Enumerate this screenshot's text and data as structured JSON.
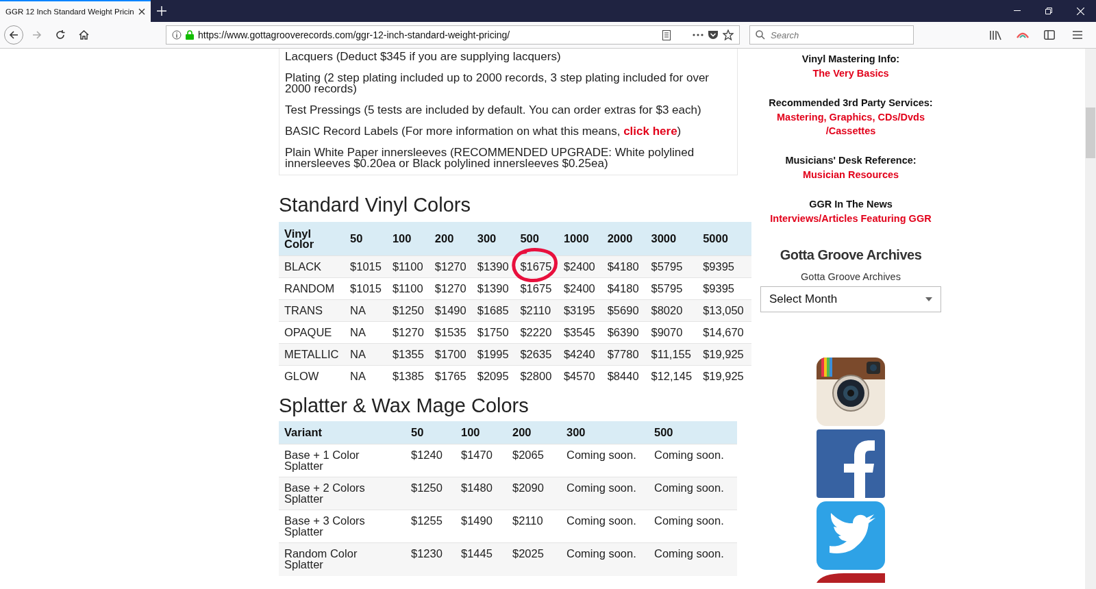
{
  "browser": {
    "tab": {
      "title": "GGR 12 Inch Standard Weight Pricin",
      "selected": true
    },
    "url": "https://www.gottagrooverecords.com/ggr-12-inch-standard-weight-pricing/",
    "search": {
      "placeholder": "Search"
    }
  },
  "includes": [
    {
      "text": "Lacquers (Deduct $345 if you are supplying lacquers)"
    },
    {
      "text": "Plating (2 step plating included up to 2000 records, 3 step plating included for over 2000 records)"
    },
    {
      "text": "Test Pressings (5 tests are included by default. You can order extras for $3 each)"
    },
    {
      "text": "BASIC Record Labels (For more information on what this means, ",
      "link": "click here",
      "after": ")"
    },
    {
      "text": "Plain White Paper innersleeves (RECOMMENDED UPGRADE: White polylined innersleeves $0.20ea or Black polylined innersleeves $0.25ea)"
    }
  ],
  "standard": {
    "title": "Standard Vinyl Colors",
    "columns": [
      "Vinyl Color",
      "50",
      "100",
      "200",
      "300",
      "500",
      "1000",
      "2000",
      "3000",
      "5000"
    ],
    "rows": [
      {
        "cells": [
          {
            "text": "BLACK",
            "circled": false
          },
          {
            "text": "$1015",
            "circled": false
          },
          {
            "text": "$1100",
            "circled": false
          },
          {
            "text": "$1270",
            "circled": false
          },
          {
            "text": "$1390",
            "circled": false
          },
          {
            "text": "$1675",
            "circled": true
          },
          {
            "text": "$2400",
            "circled": false
          },
          {
            "text": "$4180",
            "circled": false
          },
          {
            "text": "$5795",
            "circled": false
          },
          {
            "text": "$9395",
            "circled": false
          }
        ]
      },
      {
        "cells": [
          {
            "text": "RANDOM",
            "circled": false
          },
          {
            "text": "$1015",
            "circled": false
          },
          {
            "text": "$1100",
            "circled": false
          },
          {
            "text": "$1270",
            "circled": false
          },
          {
            "text": "$1390",
            "circled": false
          },
          {
            "text": "$1675",
            "circled": false
          },
          {
            "text": "$2400",
            "circled": false
          },
          {
            "text": "$4180",
            "circled": false
          },
          {
            "text": "$5795",
            "circled": false
          },
          {
            "text": "$9395",
            "circled": false
          }
        ]
      },
      {
        "cells": [
          {
            "text": "TRANS",
            "circled": false
          },
          {
            "text": "NA",
            "circled": false
          },
          {
            "text": "$1250",
            "circled": false
          },
          {
            "text": "$1490",
            "circled": false
          },
          {
            "text": "$1685",
            "circled": false
          },
          {
            "text": "$2110",
            "circled": false
          },
          {
            "text": "$3195",
            "circled": false
          },
          {
            "text": "$5690",
            "circled": false
          },
          {
            "text": "$8020",
            "circled": false
          },
          {
            "text": "$13,050",
            "circled": false
          }
        ]
      },
      {
        "cells": [
          {
            "text": "OPAQUE",
            "circled": false
          },
          {
            "text": "NA",
            "circled": false
          },
          {
            "text": "$1270",
            "circled": false
          },
          {
            "text": "$1535",
            "circled": false
          },
          {
            "text": "$1750",
            "circled": false
          },
          {
            "text": "$2220",
            "circled": false
          },
          {
            "text": "$3545",
            "circled": false
          },
          {
            "text": "$6390",
            "circled": false
          },
          {
            "text": "$9070",
            "circled": false
          },
          {
            "text": "$14,670",
            "circled": false
          }
        ]
      },
      {
        "cells": [
          {
            "text": "METALLIC",
            "circled": false
          },
          {
            "text": "NA",
            "circled": false
          },
          {
            "text": "$1355",
            "circled": false
          },
          {
            "text": "$1700",
            "circled": false
          },
          {
            "text": "$1995",
            "circled": false
          },
          {
            "text": "$2635",
            "circled": false
          },
          {
            "text": "$4240",
            "circled": false
          },
          {
            "text": "$7780",
            "circled": false
          },
          {
            "text": "$11,155",
            "circled": false
          },
          {
            "text": "$19,925",
            "circled": false
          }
        ]
      },
      {
        "cells": [
          {
            "text": "GLOW",
            "circled": false
          },
          {
            "text": "NA",
            "circled": false
          },
          {
            "text": "$1385",
            "circled": false
          },
          {
            "text": "$1765",
            "circled": false
          },
          {
            "text": "$2095",
            "circled": false
          },
          {
            "text": "$2800",
            "circled": false
          },
          {
            "text": "$4570",
            "circled": false
          },
          {
            "text": "$8440",
            "circled": false
          },
          {
            "text": "$12,145",
            "circled": false
          },
          {
            "text": "$19,925",
            "circled": false
          }
        ]
      }
    ]
  },
  "splatter": {
    "title": "Splatter & Wax Mage Colors",
    "columns": [
      "Variant",
      "50",
      "100",
      "200",
      "300",
      "500"
    ],
    "rows": [
      [
        "Base + 1 Color Splatter",
        "$1240",
        "$1470",
        "$2065",
        "Coming soon.",
        "Coming soon."
      ],
      [
        "Base + 2 Colors Splatter",
        "$1250",
        "$1480",
        "$2090",
        "Coming soon.",
        "Coming soon."
      ],
      [
        "Base + 3 Colors Splatter",
        "$1255",
        "$1490",
        "$2110",
        "Coming soon.",
        "Coming soon."
      ],
      [
        "Random Color Splatter",
        "$1230",
        "$1445",
        "$2025",
        "Coming soon.",
        "Coming soon."
      ]
    ]
  },
  "sidebar": {
    "sections": [
      {
        "heading": "Vinyl Mastering Info:",
        "link": "The Very Basics"
      },
      {
        "heading": "Recommended 3rd Party Services:",
        "link": "Mastering, Graphics, CDs/Dvds /Cassettes"
      },
      {
        "heading": "Musicians' Desk Reference:",
        "link": "Musician Resources"
      },
      {
        "heading": "GGR In The News",
        "link": "Interviews/Articles Featuring GGR"
      }
    ],
    "archives": {
      "title": "Gotta Groove Archives",
      "label": "Gotta Groove Archives",
      "select": "Select Month"
    },
    "social": [
      {
        "kind": "camera"
      },
      {
        "kind": "facebook"
      },
      {
        "kind": "bird"
      },
      {
        "kind": "partial"
      }
    ]
  }
}
